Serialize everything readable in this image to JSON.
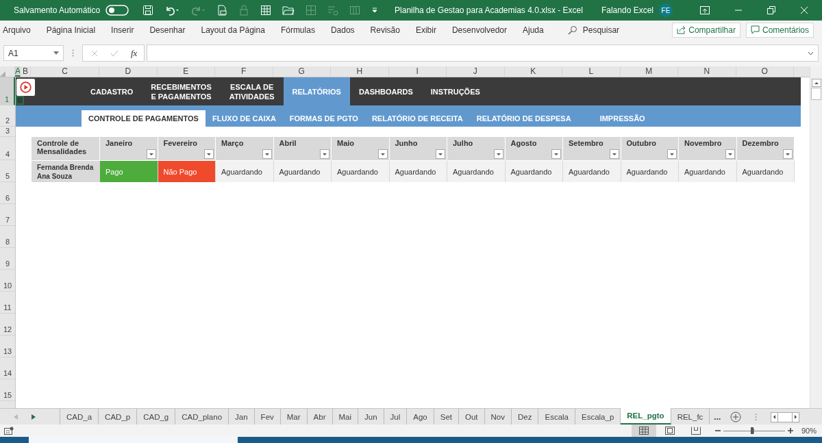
{
  "title_bar": {
    "autosave_label": "Salvamento Automático",
    "autosave_on": false,
    "document_title": "Planilha de Gestao para Academias 4.0.xlsx  -  Excel",
    "user_name": "Falando Excel",
    "user_initials": "FE"
  },
  "ribbon": {
    "tabs": [
      "Arquivo",
      "Página Inicial",
      "Inserir",
      "Desenhar",
      "Layout da Página",
      "Fórmulas",
      "Dados",
      "Revisão",
      "Exibir",
      "Desenvolvedor",
      "Ajuda"
    ],
    "search_label": "Pesquisar",
    "share_label": "Compartilhar",
    "comments_label": "Comentários"
  },
  "formula_bar": {
    "name_box": "A1",
    "function_label": "fx"
  },
  "column_headers": [
    "A",
    "B",
    "C",
    "D",
    "E",
    "F",
    "G",
    "H",
    "I",
    "J",
    "K",
    "L",
    "M",
    "N",
    "O"
  ],
  "row_numbers": [
    "1",
    "2",
    "3",
    "4",
    "5",
    "6",
    "7",
    "8",
    "9",
    "10",
    "11",
    "12",
    "13",
    "14",
    "15"
  ],
  "nav_menu": {
    "items": [
      {
        "label": "CADASTRO",
        "selected": false
      },
      {
        "label": "RECEBIMENTOS\nE PAGAMENTOS",
        "selected": false
      },
      {
        "label": "ESCALA DE\nATIVIDADES",
        "selected": false
      },
      {
        "label": "RELATÓRIOS",
        "selected": true
      },
      {
        "label": "DASHBOARDS",
        "selected": false
      },
      {
        "label": "INSTRUÇÕES",
        "selected": false
      }
    ]
  },
  "sub_menu": {
    "items": [
      {
        "label": "CONTROLE DE PAGAMENTOS",
        "selected": true
      },
      {
        "label": "FLUXO DE CAIXA",
        "selected": false
      },
      {
        "label": "FORMAS DE PGTO",
        "selected": false
      },
      {
        "label": "RELATÓRIO DE RECEITA",
        "selected": false
      },
      {
        "label": "RELATÓRIO DE DESPESA",
        "selected": false
      },
      {
        "label": "IMPRESSÃO",
        "selected": false
      }
    ]
  },
  "table": {
    "header_label": "Controle de Mensalidades",
    "columns": [
      "Janeiro",
      "Fevereiro",
      "Março",
      "Abril",
      "Maio",
      "Junho",
      "Julho",
      "Agosto",
      "Setembro",
      "Outubro",
      "Novembro",
      "Dezembro"
    ],
    "rows": [
      {
        "name": "Fernanda Brenda Ana Souza",
        "cells": [
          {
            "text": "Pago",
            "color": "#4dac3c"
          },
          {
            "text": "Não Pago",
            "color": "#f04a2d"
          },
          {
            "text": "Aguardando",
            "color": "#f2f2f2"
          },
          {
            "text": "Aguardando",
            "color": "#f2f2f2"
          },
          {
            "text": "Aguardando",
            "color": "#f2f2f2"
          },
          {
            "text": "Aguardando",
            "color": "#f2f2f2"
          },
          {
            "text": "Aguardando",
            "color": "#f2f2f2"
          },
          {
            "text": "Aguardando",
            "color": "#f2f2f2"
          },
          {
            "text": "Aguardando",
            "color": "#f2f2f2"
          },
          {
            "text": "Aguardando",
            "color": "#f2f2f2"
          },
          {
            "text": "Aguardando",
            "color": "#f2f2f2"
          },
          {
            "text": "Aguardando",
            "color": "#f2f2f2"
          }
        ]
      }
    ]
  },
  "sheet_tabs": {
    "tabs": [
      {
        "label": "CAD_a",
        "selected": false
      },
      {
        "label": "CAD_p",
        "selected": false
      },
      {
        "label": "CAD_g",
        "selected": false
      },
      {
        "label": "CAD_plano",
        "selected": false
      },
      {
        "label": "Jan",
        "selected": false
      },
      {
        "label": "Fev",
        "selected": false
      },
      {
        "label": "Mar",
        "selected": false
      },
      {
        "label": "Abr",
        "selected": false
      },
      {
        "label": "Mai",
        "selected": false
      },
      {
        "label": "Jun",
        "selected": false
      },
      {
        "label": "Jul",
        "selected": false
      },
      {
        "label": "Ago",
        "selected": false
      },
      {
        "label": "Set",
        "selected": false
      },
      {
        "label": "Out",
        "selected": false
      },
      {
        "label": "Nov",
        "selected": false
      },
      {
        "label": "Dez",
        "selected": false
      },
      {
        "label": "Escala",
        "selected": false
      },
      {
        "label": "Escala_p",
        "selected": false
      },
      {
        "label": "REL_pgto",
        "selected": true
      },
      {
        "label": "REL_fc",
        "selected": false
      }
    ],
    "more_label": "..."
  },
  "status_bar": {
    "zoom_label": "90%",
    "zoom": {
      "level": 0.47
    }
  }
}
